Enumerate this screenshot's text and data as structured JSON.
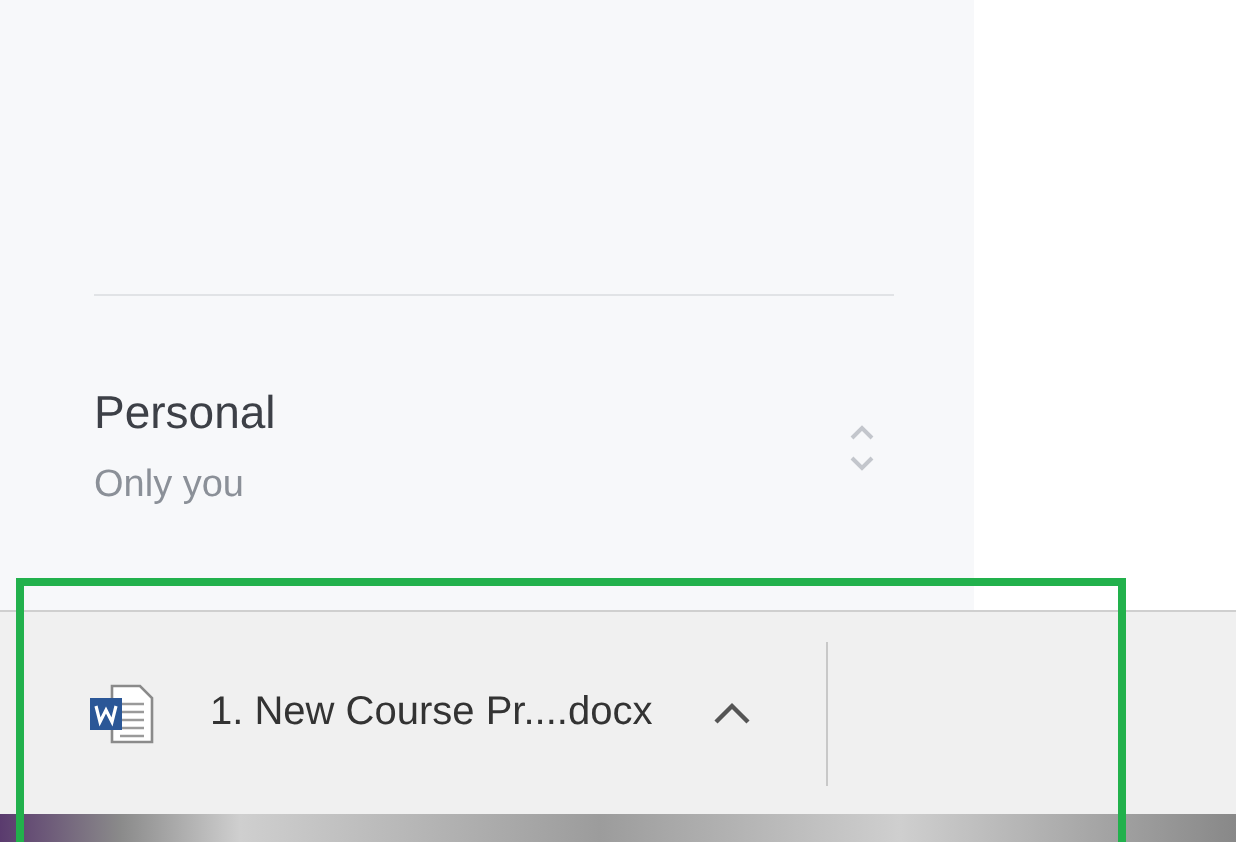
{
  "panel": {
    "title": "Personal",
    "subtitle": "Only you"
  },
  "download_bar": {
    "items": [
      {
        "kind": "word",
        "file_name": "1. New Course Pr....docx"
      }
    ]
  }
}
